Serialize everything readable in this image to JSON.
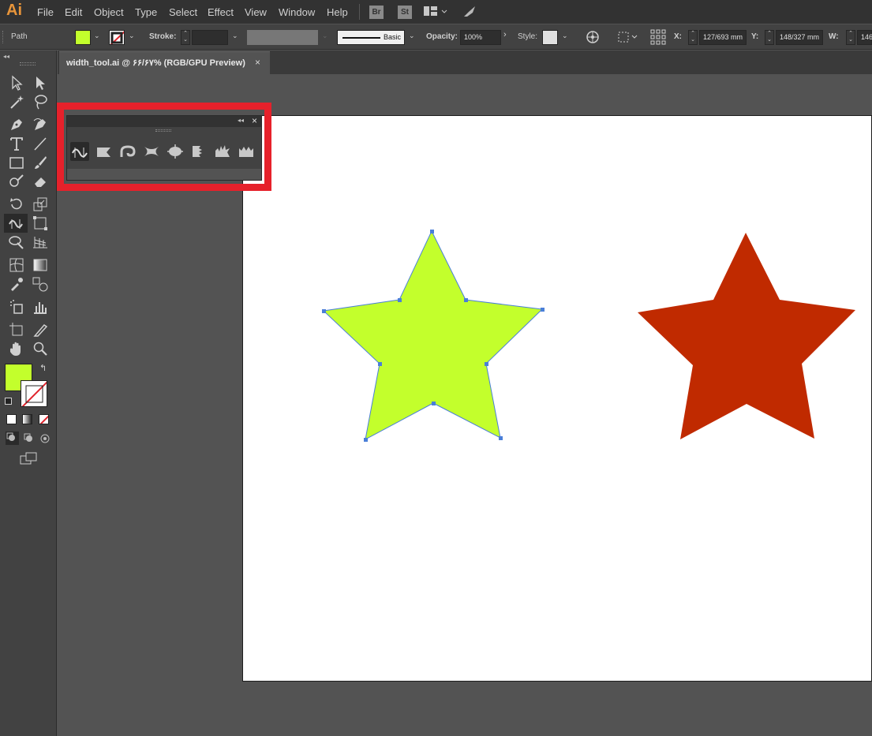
{
  "app": {
    "logo": "Ai"
  },
  "menu": [
    "File",
    "Edit",
    "Object",
    "Type",
    "Select",
    "Effect",
    "View",
    "Window",
    "Help"
  ],
  "menubar_buttons": [
    "Br",
    "St"
  ],
  "control": {
    "selection_label": "Path",
    "fill_color": "#c3ff2c",
    "stroke_label": "Stroke:",
    "brush_label": "Basic",
    "opacity_label": "Opacity:",
    "opacity_value": "100%",
    "style_label": "Style:",
    "x_label": "X:",
    "x_value": "127/693 mm",
    "y_label": "Y:",
    "y_value": "148/327 mm",
    "w_label": "W:",
    "w_value": "146"
  },
  "document": {
    "tab_title": "width_tool.ai @ ۶۶/۶۷% (RGB/GPU Preview)",
    "close": "×"
  },
  "panel": {
    "collapse": "◂◂",
    "close": "×",
    "tools": [
      "width-tool",
      "warp-tool",
      "twirl-tool",
      "pucker-tool",
      "bloat-tool",
      "scallop-tool",
      "crystallize-tool",
      "wrinkle-tool"
    ]
  },
  "colors": {
    "fill_swatch": "#c3ff2c",
    "star_left": "#c3ff2c",
    "star_right": "#c02a00",
    "selection_blue": "#4a7fd8",
    "highlight": "#e6212b"
  }
}
